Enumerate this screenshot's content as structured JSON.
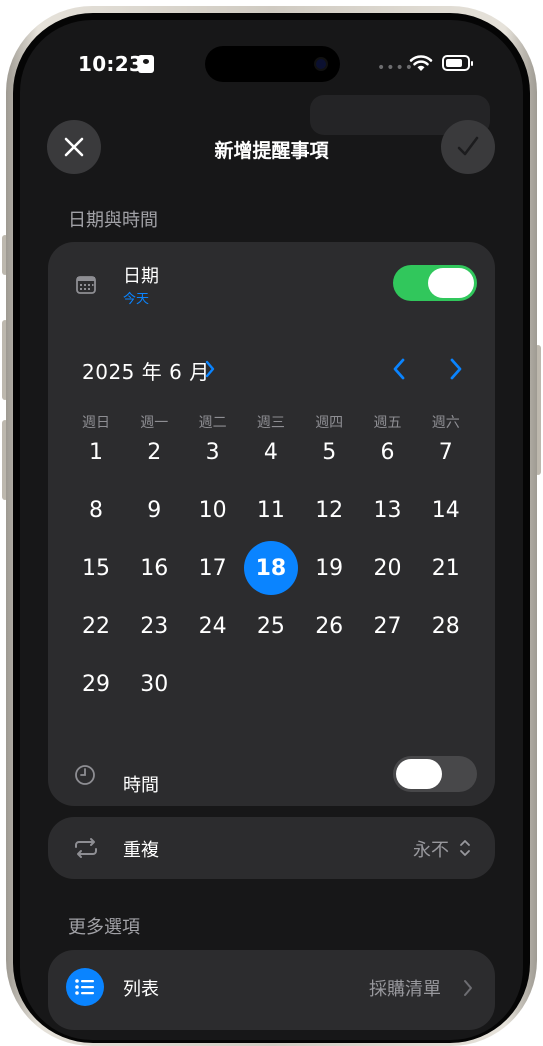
{
  "status_bar": {
    "time": "10:23"
  },
  "nav": {
    "title": "新增提醒事項",
    "close_icon": "xmark-icon",
    "confirm_icon": "checkmark-icon"
  },
  "sections": {
    "date_time": "日期與時間",
    "more_options": "更多選項"
  },
  "date_row": {
    "label": "日期",
    "sub": "今天",
    "toggle_on": true,
    "icon": "calendar-icon"
  },
  "calendar": {
    "month_title": "2025 年 6 月",
    "weekdays": [
      "週日",
      "週一",
      "週二",
      "週三",
      "週四",
      "週五",
      "週六"
    ],
    "days": [
      "1",
      "2",
      "3",
      "4",
      "5",
      "6",
      "7",
      "8",
      "9",
      "10",
      "11",
      "12",
      "13",
      "14",
      "15",
      "16",
      "17",
      "18",
      "19",
      "20",
      "21",
      "22",
      "23",
      "24",
      "25",
      "26",
      "27",
      "28",
      "29",
      "30"
    ],
    "first_weekday_index": 0,
    "selected_day": "18",
    "accent": "#0a84ff"
  },
  "time_row": {
    "label": "時間",
    "toggle_on": false,
    "icon": "clock-icon"
  },
  "repeat_row": {
    "label": "重複",
    "value": "永不",
    "icon": "repeat-icon"
  },
  "list_row": {
    "label": "列表",
    "value": "採購清單",
    "icon": "list-bullet-icon"
  },
  "colors": {
    "toggle_on": "#31c75c",
    "card": "#2c2c2e",
    "background": "#171718"
  }
}
